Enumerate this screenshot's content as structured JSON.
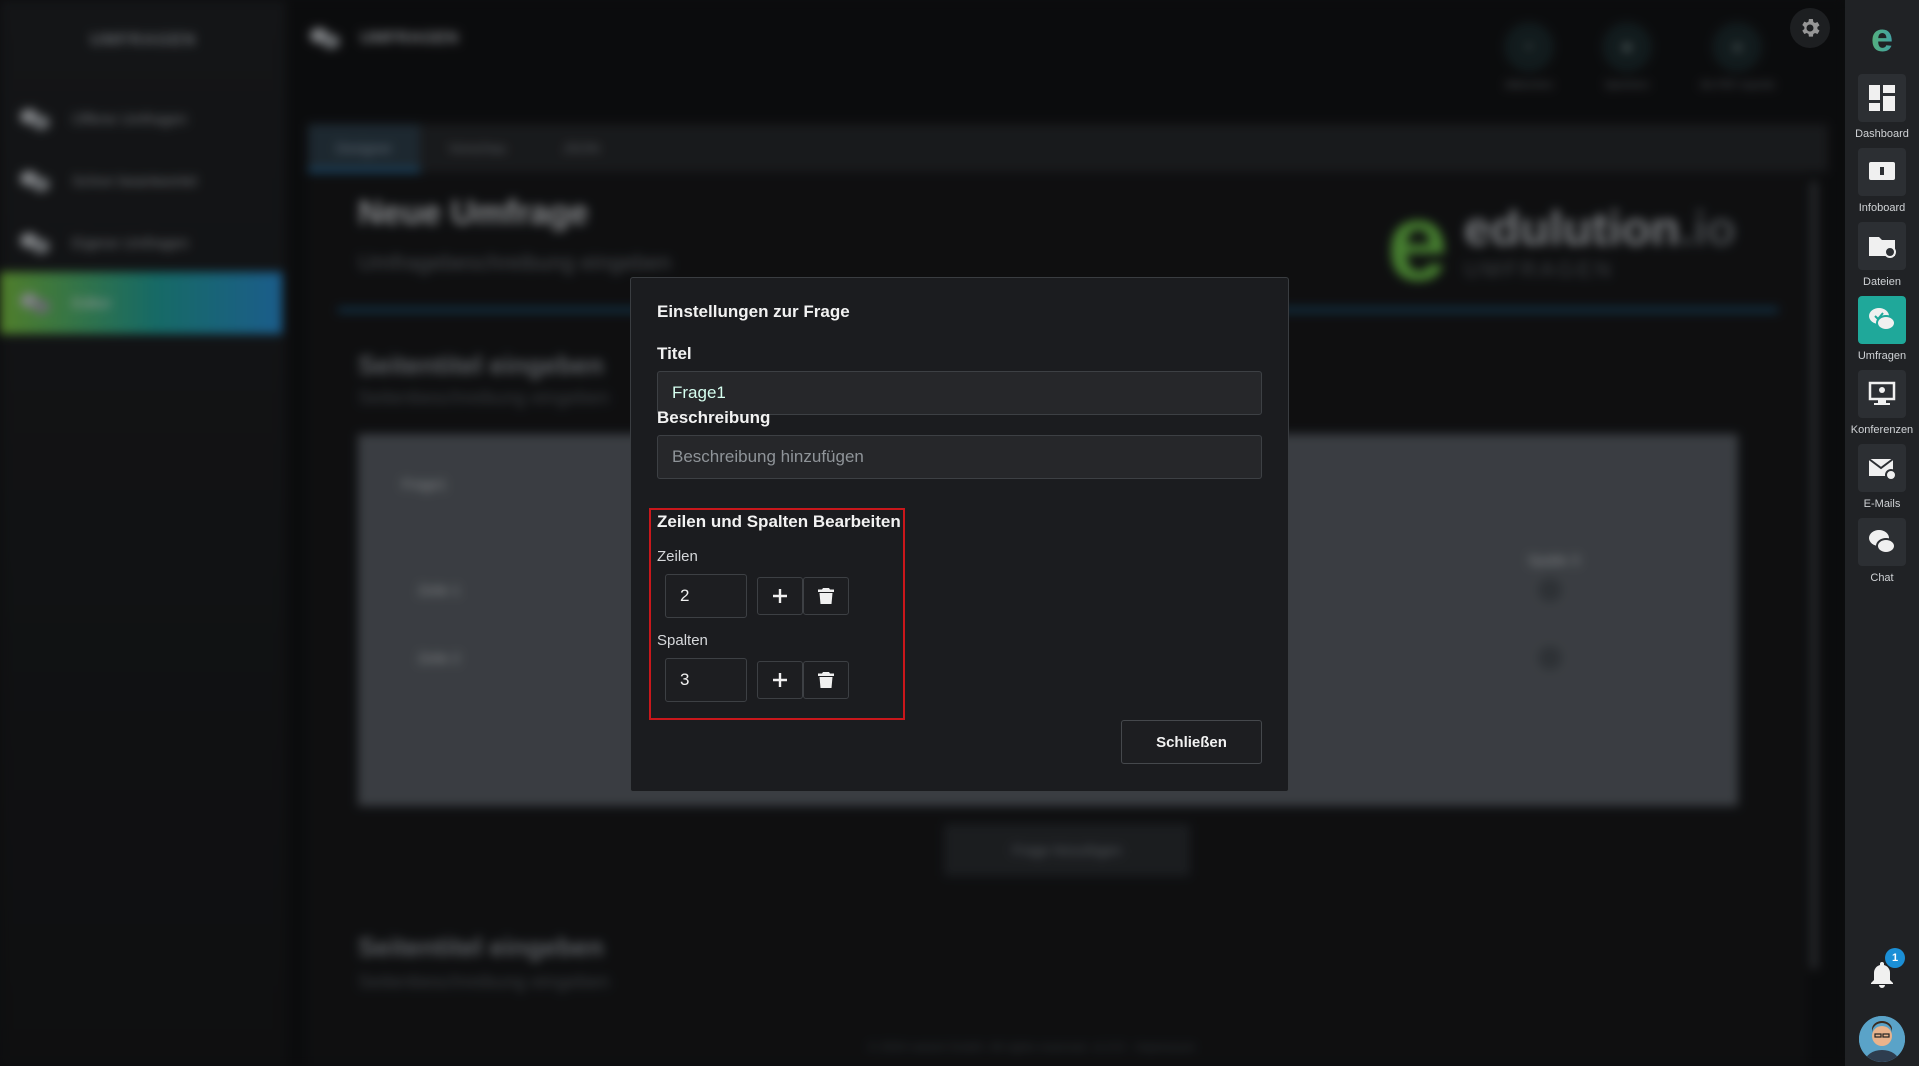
{
  "sidebar": {
    "title": "UMFRAGEN",
    "items": [
      {
        "label": "Offene Umfragen"
      },
      {
        "label": "Schon beantwortet"
      },
      {
        "label": "Eigene Umfragen"
      },
      {
        "label": "Editor"
      }
    ]
  },
  "header": {
    "title": "UMFRAGEN",
    "actions": [
      {
        "label": "Abbrechen"
      },
      {
        "label": "Speichern"
      },
      {
        "label": "Als PDF exportie"
      }
    ]
  },
  "editor": {
    "tabs": [
      {
        "label": "Designer"
      },
      {
        "label": "Vorschau"
      },
      {
        "label": "JSON"
      }
    ],
    "survey_title": "Neue Umfrage",
    "survey_description": "Umfragebeschreibung eingeben",
    "brand_name": "edulution",
    "brand_suffix": ".io",
    "brand_sub": "UMFRAGEN",
    "page1_title": "Seitentitel eingeben",
    "page1_description": "Seitenbeschreibung eingeben",
    "matrix_question": "Frage1",
    "matrix_rows": [
      "Zeile 1",
      "Zeile 2"
    ],
    "matrix_column": "Spalte 3",
    "add_question_label": "Frage hinzufügen",
    "page2_title": "Seitentitel eingeben",
    "page2_description": "Seitenbeschreibung eingeben",
    "footer": "© 2024 netzint GmbH. All rights reserved. v1.0.0 · Impressum"
  },
  "dock": {
    "logo": "e",
    "items": [
      {
        "label": "Dashboard",
        "icon": "dashboard-icon"
      },
      {
        "label": "Infoboard",
        "icon": "infoboard-icon"
      },
      {
        "label": "Dateien",
        "icon": "folder-icon"
      },
      {
        "label": "Umfragen",
        "icon": "survey-icon"
      },
      {
        "label": "Konferenzen",
        "icon": "conference-icon"
      },
      {
        "label": "E-Mails",
        "icon": "mail-icon"
      },
      {
        "label": "Chat",
        "icon": "chat-icon"
      }
    ],
    "notification_count": "1"
  },
  "dialog": {
    "title": "Einstellungen zur Frage",
    "title_field": {
      "label": "Titel",
      "value": "Frage1"
    },
    "description_field": {
      "label": "Beschreibung",
      "placeholder": "Beschreibung hinzufügen",
      "value": ""
    },
    "matrix_section": {
      "title": "Zeilen und Spalten Bearbeiten",
      "rows_label": "Zeilen",
      "rows_value": "2",
      "columns_label": "Spalten",
      "columns_value": "3"
    },
    "close_label": "Schließen"
  },
  "colors": {
    "accent_green": "#6cc24a",
    "accent_blue": "#2a8fd6",
    "highlight_red": "#c9171b",
    "dock_active": "#1fa89a"
  }
}
